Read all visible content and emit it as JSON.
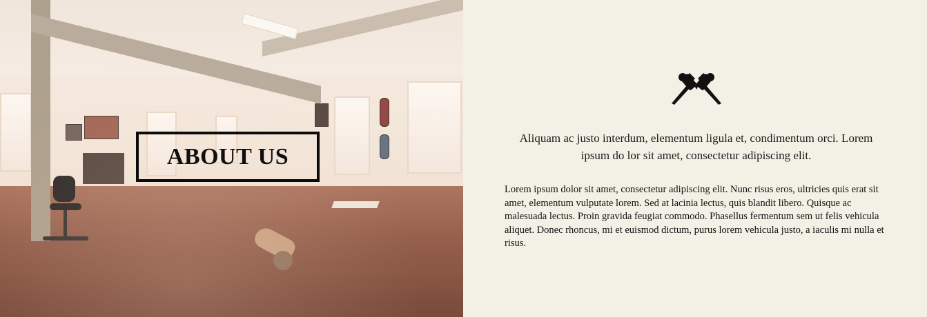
{
  "hero": {
    "title": "ABOUT US",
    "image_alt": "tattoo studio interior"
  },
  "logo": {
    "icon": "crossed-tattoo-machines-icon"
  },
  "content": {
    "lead": "Aliquam ac justo interdum, elementum ligula et, condimentum orci. Lorem ipsum do lor sit amet, consectetur adipiscing elit.",
    "body": "Lorem ipsum dolor sit amet, consectetur adipiscing elit. Nunc risus eros, ultricies quis erat sit amet, elementum vulputate lorem. Sed at lacinia lectus, quis blandit libero. Quisque ac malesuada lectus. Proin gravida feugiat commodo. Phasellus fermentum sem ut felis vehicula aliquet. Donec rhoncus, mi et euismod dictum, purus lorem vehicula justo, a iaculis mi nulla et risus."
  },
  "colors": {
    "panel_bg": "#f3f0e6",
    "title_color": "#0f0f0f",
    "text_color": "#111111"
  }
}
